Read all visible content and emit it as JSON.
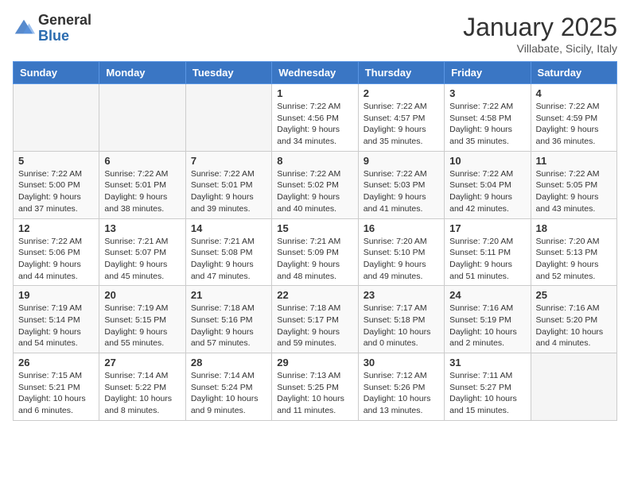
{
  "header": {
    "logo_general": "General",
    "logo_blue": "Blue",
    "month_title": "January 2025",
    "location": "Villabate, Sicily, Italy"
  },
  "weekdays": [
    "Sunday",
    "Monday",
    "Tuesday",
    "Wednesday",
    "Thursday",
    "Friday",
    "Saturday"
  ],
  "weeks": [
    {
      "days": [
        {
          "number": "",
          "info": ""
        },
        {
          "number": "",
          "info": ""
        },
        {
          "number": "",
          "info": ""
        },
        {
          "number": "1",
          "info": "Sunrise: 7:22 AM\nSunset: 4:56 PM\nDaylight: 9 hours\nand 34 minutes."
        },
        {
          "number": "2",
          "info": "Sunrise: 7:22 AM\nSunset: 4:57 PM\nDaylight: 9 hours\nand 35 minutes."
        },
        {
          "number": "3",
          "info": "Sunrise: 7:22 AM\nSunset: 4:58 PM\nDaylight: 9 hours\nand 35 minutes."
        },
        {
          "number": "4",
          "info": "Sunrise: 7:22 AM\nSunset: 4:59 PM\nDaylight: 9 hours\nand 36 minutes."
        }
      ]
    },
    {
      "days": [
        {
          "number": "5",
          "info": "Sunrise: 7:22 AM\nSunset: 5:00 PM\nDaylight: 9 hours\nand 37 minutes."
        },
        {
          "number": "6",
          "info": "Sunrise: 7:22 AM\nSunset: 5:01 PM\nDaylight: 9 hours\nand 38 minutes."
        },
        {
          "number": "7",
          "info": "Sunrise: 7:22 AM\nSunset: 5:01 PM\nDaylight: 9 hours\nand 39 minutes."
        },
        {
          "number": "8",
          "info": "Sunrise: 7:22 AM\nSunset: 5:02 PM\nDaylight: 9 hours\nand 40 minutes."
        },
        {
          "number": "9",
          "info": "Sunrise: 7:22 AM\nSunset: 5:03 PM\nDaylight: 9 hours\nand 41 minutes."
        },
        {
          "number": "10",
          "info": "Sunrise: 7:22 AM\nSunset: 5:04 PM\nDaylight: 9 hours\nand 42 minutes."
        },
        {
          "number": "11",
          "info": "Sunrise: 7:22 AM\nSunset: 5:05 PM\nDaylight: 9 hours\nand 43 minutes."
        }
      ]
    },
    {
      "days": [
        {
          "number": "12",
          "info": "Sunrise: 7:22 AM\nSunset: 5:06 PM\nDaylight: 9 hours\nand 44 minutes."
        },
        {
          "number": "13",
          "info": "Sunrise: 7:21 AM\nSunset: 5:07 PM\nDaylight: 9 hours\nand 45 minutes."
        },
        {
          "number": "14",
          "info": "Sunrise: 7:21 AM\nSunset: 5:08 PM\nDaylight: 9 hours\nand 47 minutes."
        },
        {
          "number": "15",
          "info": "Sunrise: 7:21 AM\nSunset: 5:09 PM\nDaylight: 9 hours\nand 48 minutes."
        },
        {
          "number": "16",
          "info": "Sunrise: 7:20 AM\nSunset: 5:10 PM\nDaylight: 9 hours\nand 49 minutes."
        },
        {
          "number": "17",
          "info": "Sunrise: 7:20 AM\nSunset: 5:11 PM\nDaylight: 9 hours\nand 51 minutes."
        },
        {
          "number": "18",
          "info": "Sunrise: 7:20 AM\nSunset: 5:13 PM\nDaylight: 9 hours\nand 52 minutes."
        }
      ]
    },
    {
      "days": [
        {
          "number": "19",
          "info": "Sunrise: 7:19 AM\nSunset: 5:14 PM\nDaylight: 9 hours\nand 54 minutes."
        },
        {
          "number": "20",
          "info": "Sunrise: 7:19 AM\nSunset: 5:15 PM\nDaylight: 9 hours\nand 55 minutes."
        },
        {
          "number": "21",
          "info": "Sunrise: 7:18 AM\nSunset: 5:16 PM\nDaylight: 9 hours\nand 57 minutes."
        },
        {
          "number": "22",
          "info": "Sunrise: 7:18 AM\nSunset: 5:17 PM\nDaylight: 9 hours\nand 59 minutes."
        },
        {
          "number": "23",
          "info": "Sunrise: 7:17 AM\nSunset: 5:18 PM\nDaylight: 10 hours\nand 0 minutes."
        },
        {
          "number": "24",
          "info": "Sunrise: 7:16 AM\nSunset: 5:19 PM\nDaylight: 10 hours\nand 2 minutes."
        },
        {
          "number": "25",
          "info": "Sunrise: 7:16 AM\nSunset: 5:20 PM\nDaylight: 10 hours\nand 4 minutes."
        }
      ]
    },
    {
      "days": [
        {
          "number": "26",
          "info": "Sunrise: 7:15 AM\nSunset: 5:21 PM\nDaylight: 10 hours\nand 6 minutes."
        },
        {
          "number": "27",
          "info": "Sunrise: 7:14 AM\nSunset: 5:22 PM\nDaylight: 10 hours\nand 8 minutes."
        },
        {
          "number": "28",
          "info": "Sunrise: 7:14 AM\nSunset: 5:24 PM\nDaylight: 10 hours\nand 9 minutes."
        },
        {
          "number": "29",
          "info": "Sunrise: 7:13 AM\nSunset: 5:25 PM\nDaylight: 10 hours\nand 11 minutes."
        },
        {
          "number": "30",
          "info": "Sunrise: 7:12 AM\nSunset: 5:26 PM\nDaylight: 10 hours\nand 13 minutes."
        },
        {
          "number": "31",
          "info": "Sunrise: 7:11 AM\nSunset: 5:27 PM\nDaylight: 10 hours\nand 15 minutes."
        },
        {
          "number": "",
          "info": ""
        }
      ]
    }
  ]
}
